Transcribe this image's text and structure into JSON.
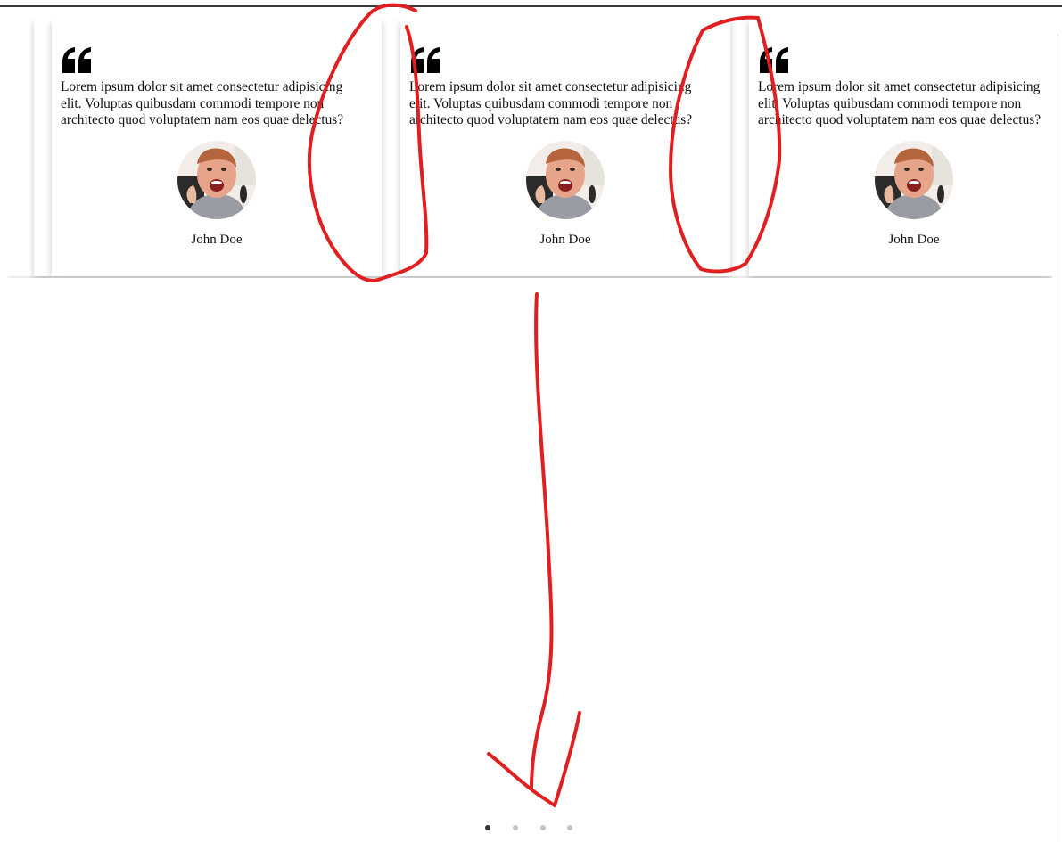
{
  "testimonials": [
    {
      "quote": "Lorem ipsum dolor sit amet consectetur adipisicing elit. Voluptas quibusdam commodi tempore non architecto quod voluptatem nam eos quae delectus?",
      "author": "John Doe",
      "avatar": "smiling-man-avatar"
    },
    {
      "quote": "Lorem ipsum dolor sit amet consectetur adipisicing elit. Voluptas quibusdam commodi tempore non architecto quod voluptatem nam eos quae delectus?",
      "author": "John Doe",
      "avatar": "smiling-man-avatar"
    },
    {
      "quote": "Lorem ipsum dolor sit amet consectetur adipisicing elit. Voluptas quibusdam commodi tempore non architecto quod voluptatem nam eos quae delectus?",
      "author": "John Doe",
      "avatar": "smiling-man-avatar"
    }
  ],
  "icons": {
    "quote": "quote-icon"
  },
  "pagination": {
    "count": 4,
    "active_index": 0,
    "active_color": "#333333",
    "inactive_color": "#c4c4c4"
  },
  "annotation": {
    "stroke_color": "#e02020"
  },
  "colors": {
    "background": "#ffffff",
    "text": "#111111"
  }
}
